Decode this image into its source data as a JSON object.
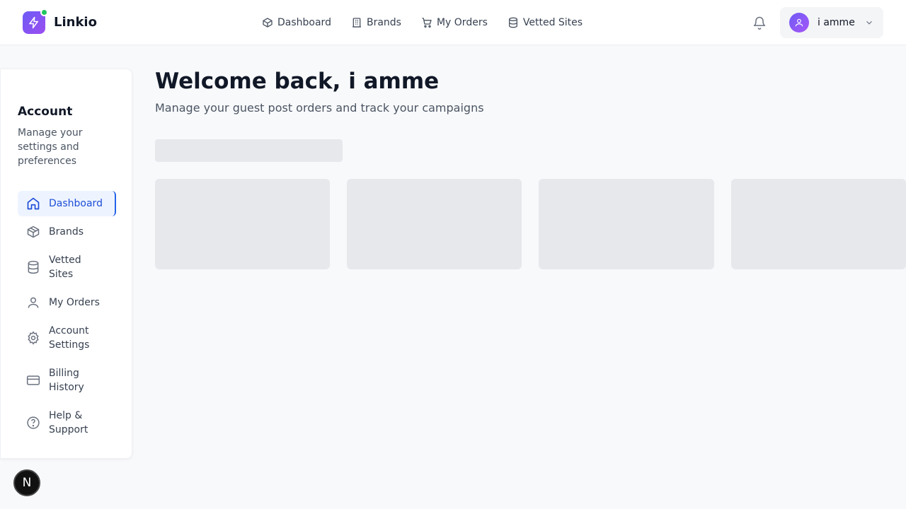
{
  "app": {
    "name": "Linkio"
  },
  "topnav": {
    "items": [
      {
        "label": "Dashboard",
        "icon": "box-icon"
      },
      {
        "label": "Brands",
        "icon": "building-icon"
      },
      {
        "label": "My Orders",
        "icon": "cart-icon"
      },
      {
        "label": "Vetted Sites",
        "icon": "database-icon"
      }
    ]
  },
  "user": {
    "name": "i amme"
  },
  "sidebar": {
    "title": "Account",
    "subtitle": "Manage your settings and preferences",
    "items": [
      {
        "label": "Dashboard",
        "icon": "home-icon",
        "active": true
      },
      {
        "label": "Brands",
        "icon": "box-icon"
      },
      {
        "label": "Vetted Sites",
        "icon": "database-icon"
      },
      {
        "label": "My Orders",
        "icon": "user-icon"
      },
      {
        "label": "Account Settings",
        "icon": "gear-icon"
      },
      {
        "label": "Billing History",
        "icon": "credit-card-icon"
      },
      {
        "label": "Help & Support",
        "icon": "help-circle-icon"
      }
    ]
  },
  "main": {
    "welcome": "Welcome back, i amme",
    "subtitle": "Manage your guest post orders and track your campaigns"
  },
  "badge": {
    "label": "N"
  },
  "colors": {
    "accent": "#2563eb",
    "brand_gradient_start": "#6d5cf6",
    "brand_gradient_end": "#9b4df0",
    "skeleton": "#e7e8ec",
    "status_dot": "#22c55e"
  }
}
